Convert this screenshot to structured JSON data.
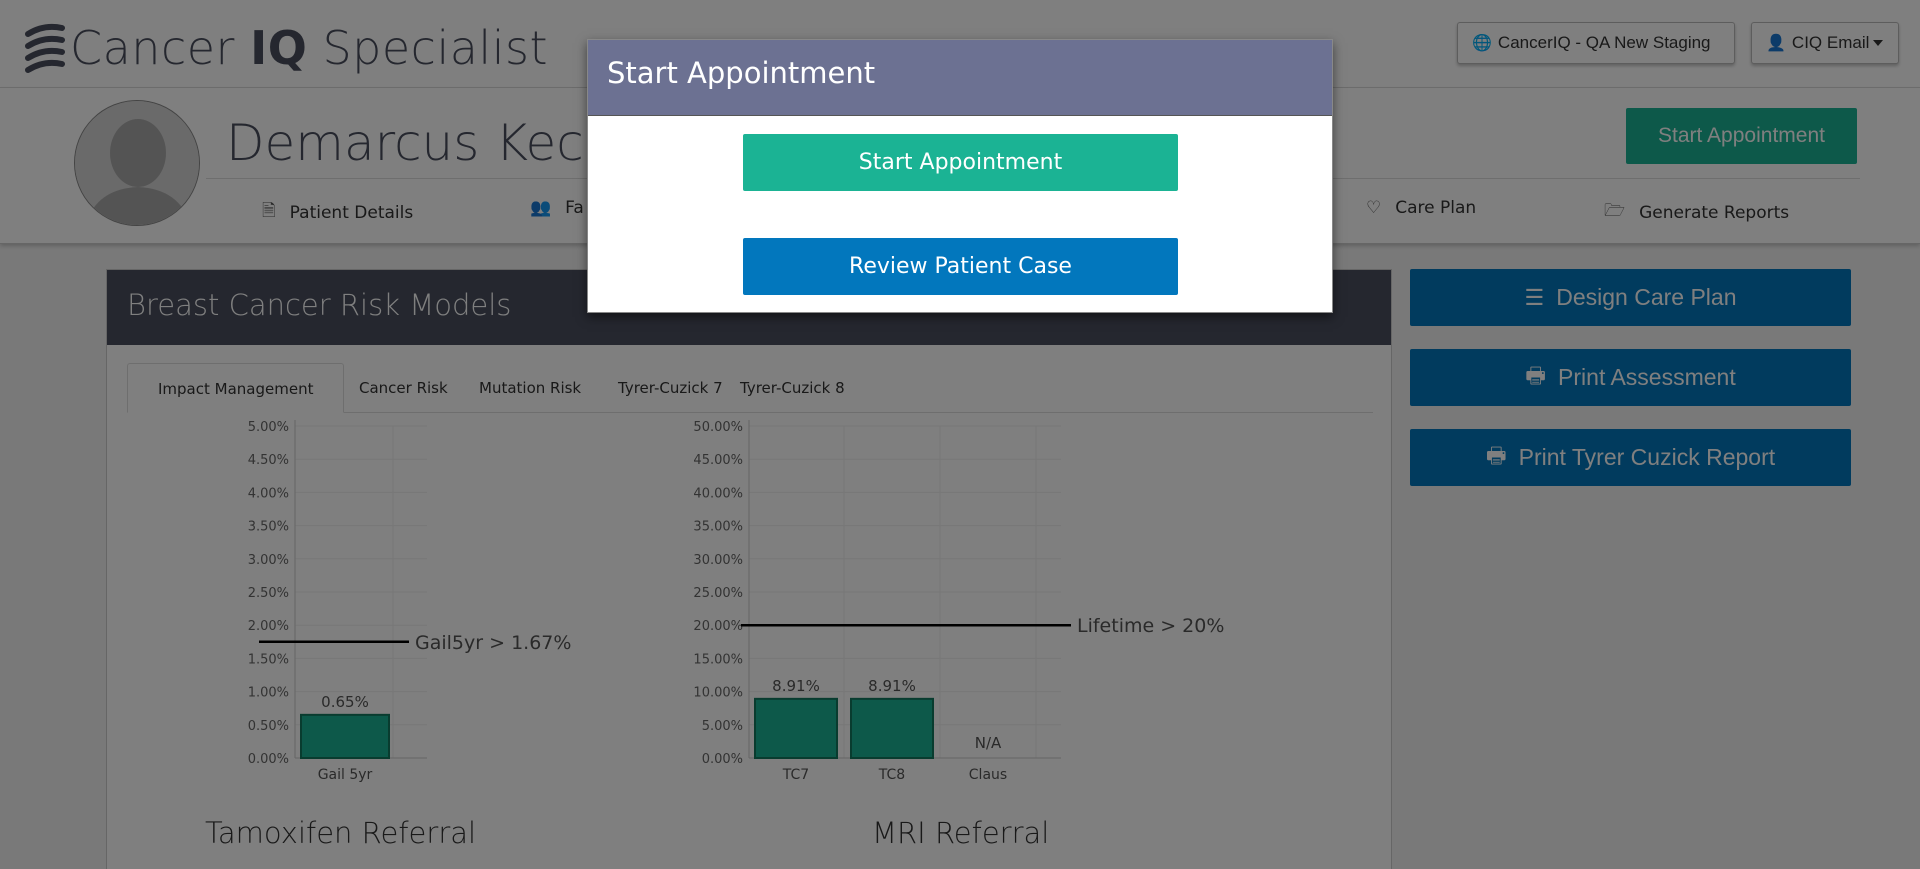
{
  "app": {
    "logo_text_1": "Cancer",
    "logo_text_2": "IQ",
    "logo_text_3": "Specialist",
    "env_button": "CancerIQ - QA New Staging",
    "user_button": "CIQ Email"
  },
  "patient": {
    "name": "Demarcus Kecia",
    "start_button": "Start Appointment",
    "nav": [
      {
        "label": "Patient Details",
        "icon": "file-icon"
      },
      {
        "label": "Fa",
        "icon": "users-icon"
      },
      {
        "label": "Care Plan",
        "icon": "heart-icon"
      },
      {
        "label": "Generate Reports",
        "icon": "folder-open-icon"
      }
    ]
  },
  "card": {
    "title": "Breast Cancer Risk Models",
    "tabs": [
      "Impact Management",
      "Cancer Risk",
      "Mutation Risk",
      "Tyrer-Cuzick 7",
      "Tyrer-Cuzick 8"
    ]
  },
  "sidebar": {
    "design_care_plan": "Design Care Plan",
    "print_assessment": "Print Assessment",
    "print_tc_report": "Print Tyrer Cuzick Report"
  },
  "modal": {
    "title": "Start Appointment",
    "start_button": "Start Appointment",
    "review_button": "Review Patient Case"
  },
  "chart_data": [
    {
      "type": "bar",
      "title": "Tamoxifen Referral",
      "categories": [
        "Gail 5yr"
      ],
      "values": [
        0.65
      ],
      "value_labels": [
        "0.65%"
      ],
      "ylim": [
        0,
        5
      ],
      "yticks": [
        "0.00%",
        "0.50%",
        "1.00%",
        "1.50%",
        "2.00%",
        "2.50%",
        "3.00%",
        "3.50%",
        "4.00%",
        "4.50%",
        "5.00%"
      ],
      "threshold": {
        "value": 1.75,
        "label": "Gail5yr > 1.67%"
      },
      "bar_color": "#1bb394"
    },
    {
      "type": "bar",
      "title": "MRI Referral",
      "categories": [
        "TC7",
        "TC8",
        "Claus"
      ],
      "values": [
        8.91,
        8.91,
        null
      ],
      "value_labels": [
        "8.91%",
        "8.91%",
        "N/A"
      ],
      "ylim": [
        0,
        50
      ],
      "yticks": [
        "0.00%",
        "5.00%",
        "10.00%",
        "15.00%",
        "20.00%",
        "25.00%",
        "30.00%",
        "35.00%",
        "40.00%",
        "45.00%",
        "50.00%"
      ],
      "threshold": {
        "value": 20,
        "label": "Lifetime > 20%"
      },
      "bar_color": "#1bb394"
    }
  ]
}
